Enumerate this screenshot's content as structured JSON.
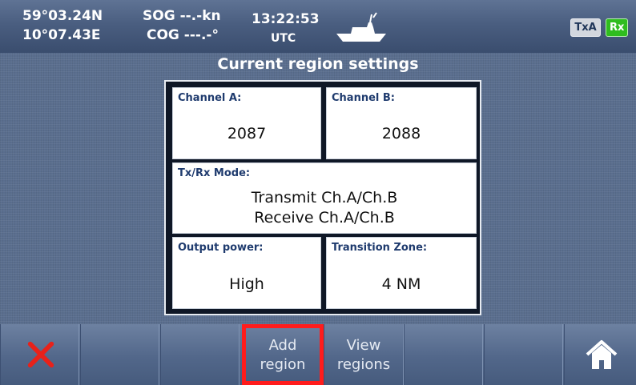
{
  "status": {
    "latitude": "59°03.24N",
    "longitude": "10°07.43E",
    "sog": "SOG --.-kn",
    "cog": "COG ---.-°",
    "time": "13:22:53",
    "timezone": "UTC",
    "badges": {
      "txa": "TxA",
      "rx": "Rx"
    },
    "icons": {
      "vessel": "ship-icon"
    }
  },
  "region": {
    "title": "Current region settings",
    "channel_a": {
      "label": "Channel A:",
      "value": "2087"
    },
    "channel_b": {
      "label": "Channel B:",
      "value": "2088"
    },
    "mode": {
      "label": "Tx/Rx Mode:",
      "line1": "Transmit Ch.A/Ch.B",
      "line2": "Receive Ch.A/Ch.B"
    },
    "output_power": {
      "label": "Output power:",
      "value": "High"
    },
    "transition_zone": {
      "label": "Transition Zone:",
      "value": "4 NM"
    }
  },
  "softkeys": {
    "cancel_icon": "close-icon",
    "add_line1": "Add",
    "add_line2": "region",
    "view_line1": "View",
    "view_line2": "regions",
    "home_icon": "home-icon"
  },
  "colors": {
    "highlight": "#ff1c1c",
    "rx_active": "#2fbd1f",
    "label_blue": "#1f3b6e",
    "cancel_red": "#e8211a"
  }
}
